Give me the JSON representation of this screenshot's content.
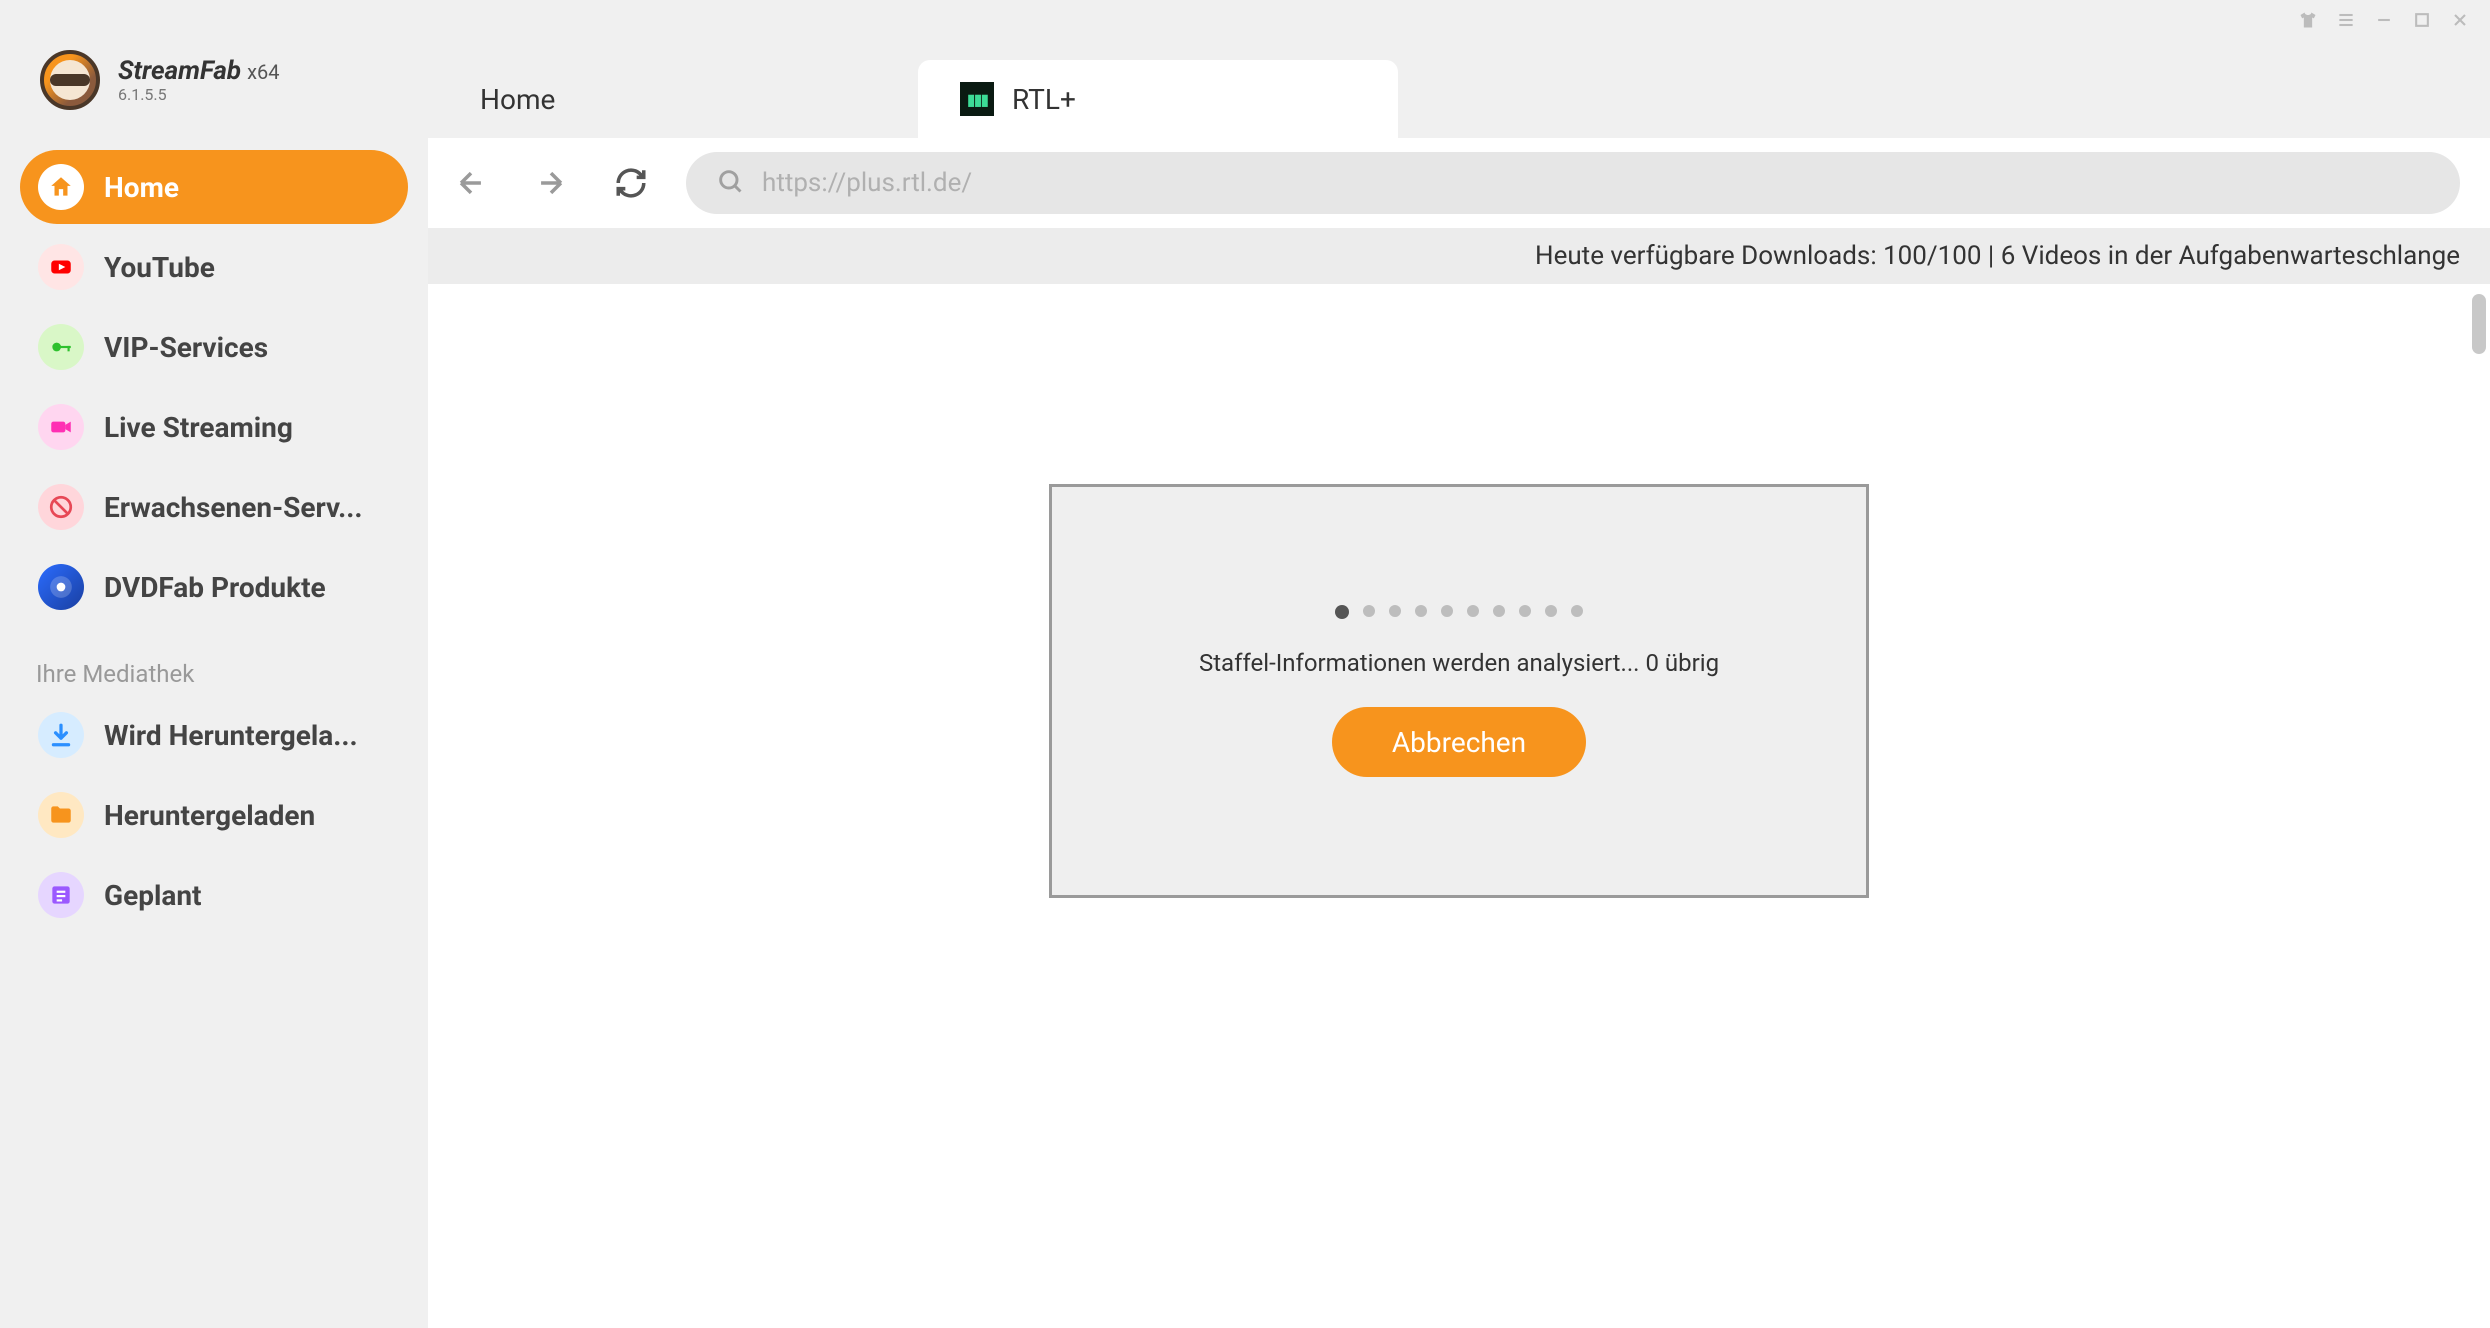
{
  "brand": {
    "name": "StreamFab",
    "arch": "x64",
    "version": "6.1.5.5"
  },
  "titlebar": {
    "icons": [
      "tshirt",
      "menu",
      "minimize",
      "maximize",
      "close"
    ]
  },
  "sidebar": {
    "items": [
      {
        "id": "home",
        "label": "Home",
        "icon": "home",
        "active": true
      },
      {
        "id": "youtube",
        "label": "YouTube",
        "icon": "youtube"
      },
      {
        "id": "vip",
        "label": "VIP-Services",
        "icon": "key"
      },
      {
        "id": "live",
        "label": "Live Streaming",
        "icon": "camera"
      },
      {
        "id": "adult",
        "label": "Erwachsenen-Serv...",
        "icon": "adult"
      },
      {
        "id": "dvdfab",
        "label": "DVDFab Produkte",
        "icon": "dvdfab"
      }
    ],
    "section_label": "Ihre Mediathek",
    "library": [
      {
        "id": "downloading",
        "label": "Wird Heruntergela...",
        "icon": "download"
      },
      {
        "id": "downloaded",
        "label": "Heruntergeladen",
        "icon": "folder"
      },
      {
        "id": "planned",
        "label": "Geplant",
        "icon": "list"
      }
    ]
  },
  "tabs": [
    {
      "id": "home",
      "label": "Home",
      "active": false
    },
    {
      "id": "rtl",
      "label": "RTL+",
      "active": true,
      "has_icon": true
    }
  ],
  "toolbar": {
    "url_placeholder": "https://plus.rtl.de/"
  },
  "status": {
    "text": "Heute verfügbare Downloads: 100/100 | 6 Videos in der Aufgabenwarteschlange"
  },
  "modal": {
    "text": "Staffel-Informationen werden analysiert... 0 übrig",
    "button": "Abbrechen"
  }
}
